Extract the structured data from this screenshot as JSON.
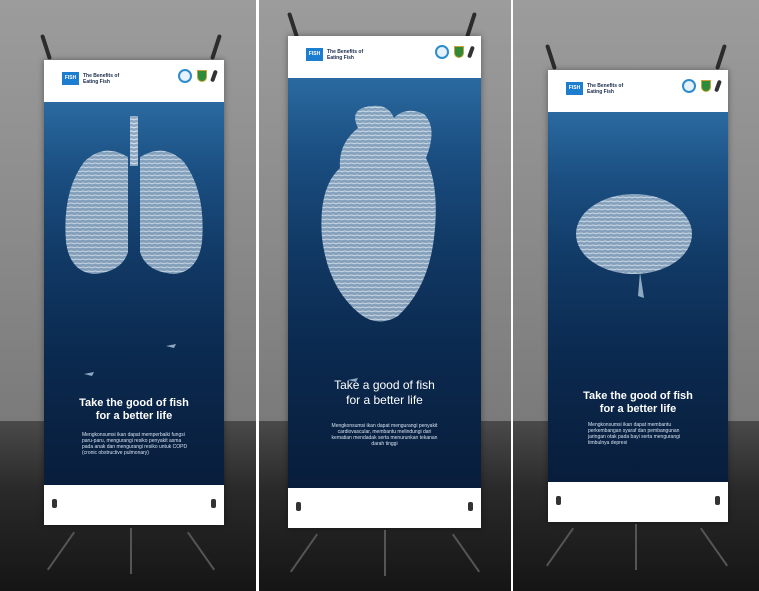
{
  "banners": [
    {
      "brand": "The Benefits of Eating Fish",
      "logo_mark": "FISH",
      "title_line1": "Take the good of fish",
      "title_line2": "for a better life",
      "body": "Mengkonsumsi ikan dapat memperbaiki fungsi paru-paru, mengurangi resiko penyakit asma pada anak dan mengurangi resiko untuk COPD (cronic obstructive pulmonary)",
      "graphic": "fish-school-lungs"
    },
    {
      "brand": "The Benefits of Eating Fish",
      "logo_mark": "FISH",
      "title_line1": "Take a good of fish",
      "title_line2": "for a better life",
      "body": "Mengkonsumsi ikan dapat mengurangi penyakit cardiovascular, membantu melindungi dari kematian mendadak serta menurunkan tekanan darah tinggi",
      "graphic": "fish-school-heart"
    },
    {
      "brand": "The Benefits of Eating Fish",
      "logo_mark": "FISH",
      "title_line1": "Take the good of fish",
      "title_line2": "for a better life",
      "body": "Mengkonsumsi ikan dapat membantu perkembangan syaraf dan pembangunan jaringan otak pada bayi serta mengurangi timbulnya depresi",
      "graphic": "fish-school-brain"
    }
  ],
  "colors": {
    "sea_top": "#2a6aa0",
    "sea_bottom": "#081d3b",
    "fish": "#c9d8e6",
    "logo_blue": "#1d7ecf"
  }
}
